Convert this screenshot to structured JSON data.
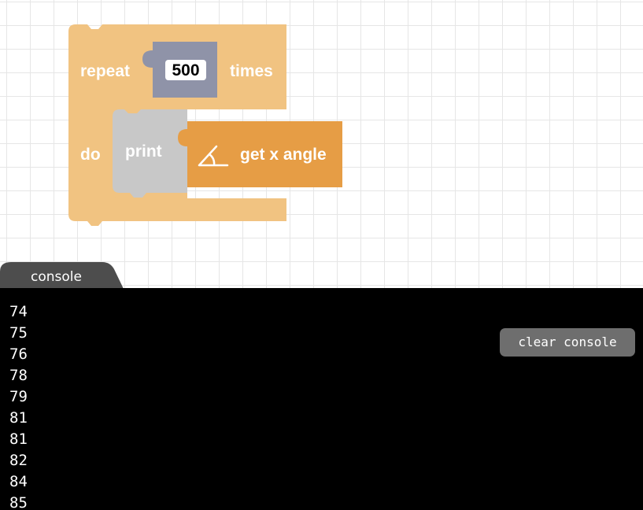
{
  "blocks": {
    "repeat": {
      "label_repeat": "repeat",
      "count": "500",
      "label_times": "times",
      "label_do": "do",
      "color": "#f1c381"
    },
    "print": {
      "label": "print",
      "color": "#c8c8c8"
    },
    "get_x_angle": {
      "label": "get x angle",
      "icon": "angle-icon",
      "color": "#e69d45"
    },
    "number_input": {
      "color": "#8f93a8"
    }
  },
  "console": {
    "tab_label": "console",
    "clear_button_label": "clear console",
    "lines": [
      "74",
      "75",
      "76",
      "78",
      "79",
      "81",
      "81",
      "82",
      "84",
      "85"
    ]
  }
}
